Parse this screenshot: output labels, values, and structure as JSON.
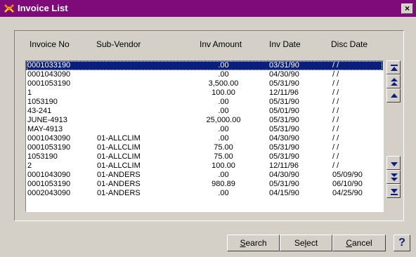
{
  "window": {
    "title": "Invoice List"
  },
  "columns": {
    "invoice_no": "Invoice No",
    "sub_vendor": "Sub-Vendor",
    "inv_amount": "Inv Amount",
    "inv_date": "Inv Date",
    "disc_date": "Disc Date"
  },
  "rows": [
    {
      "invoice_no": "0001033190",
      "sub_vendor": "",
      "inv_amount": ".00",
      "inv_date": "03/31/90",
      "disc_date": "/ /",
      "selected": true
    },
    {
      "invoice_no": "0001043090",
      "sub_vendor": "",
      "inv_amount": ".00",
      "inv_date": "04/30/90",
      "disc_date": "/ /"
    },
    {
      "invoice_no": "0001053190",
      "sub_vendor": "",
      "inv_amount": "3,500.00",
      "inv_date": "05/31/90",
      "disc_date": "/ /"
    },
    {
      "invoice_no": "1",
      "sub_vendor": "",
      "inv_amount": "100.00",
      "inv_date": "12/11/96",
      "disc_date": "/ /"
    },
    {
      "invoice_no": "1053190",
      "sub_vendor": "",
      "inv_amount": ".00",
      "inv_date": "05/31/90",
      "disc_date": "/ /"
    },
    {
      "invoice_no": "43-241",
      "sub_vendor": "",
      "inv_amount": ".00",
      "inv_date": "05/01/90",
      "disc_date": "/ /"
    },
    {
      "invoice_no": "JUNE-4913",
      "sub_vendor": "",
      "inv_amount": "25,000.00",
      "inv_date": "05/31/90",
      "disc_date": "/ /"
    },
    {
      "invoice_no": "MAY-4913",
      "sub_vendor": "",
      "inv_amount": ".00",
      "inv_date": "05/31/90",
      "disc_date": "/ /"
    },
    {
      "invoice_no": "0001043090",
      "sub_vendor": "01-ALLCLIM",
      "inv_amount": ".00",
      "inv_date": "04/30/90",
      "disc_date": "/ /"
    },
    {
      "invoice_no": "0001053190",
      "sub_vendor": "01-ALLCLIM",
      "inv_amount": "75.00",
      "inv_date": "05/31/90",
      "disc_date": "/ /"
    },
    {
      "invoice_no": "1053190",
      "sub_vendor": "01-ALLCLIM",
      "inv_amount": "75.00",
      "inv_date": "05/31/90",
      "disc_date": "/ /"
    },
    {
      "invoice_no": "2",
      "sub_vendor": "01-ALLCLIM",
      "inv_amount": "100.00",
      "inv_date": "12/11/96",
      "disc_date": "/ /"
    },
    {
      "invoice_no": "0001043090",
      "sub_vendor": "01-ANDERS",
      "inv_amount": ".00",
      "inv_date": "04/30/90",
      "disc_date": "05/09/90"
    },
    {
      "invoice_no": "0001053190",
      "sub_vendor": "01-ANDERS",
      "inv_amount": "980.89",
      "inv_date": "05/31/90",
      "disc_date": "06/10/90"
    },
    {
      "invoice_no": "0002043090",
      "sub_vendor": "01-ANDERS",
      "inv_amount": ".00",
      "inv_date": "04/15/90",
      "disc_date": "04/25/90"
    }
  ],
  "buttons": {
    "search": {
      "pre": "",
      "key": "S",
      "post": "earch"
    },
    "select": {
      "pre": "Se",
      "key": "l",
      "post": "ect"
    },
    "cancel": {
      "pre": "",
      "key": "C",
      "post": "ancel"
    },
    "help": "?"
  },
  "colors": {
    "titlebar": "#7f0a7a",
    "selection": "#0a1f7d"
  },
  "icons": {
    "window": "app-logo-icon",
    "close": "close-icon",
    "scroll": [
      "scroll-top-icon",
      "page-up-icon",
      "line-up-icon",
      "line-down-icon",
      "page-down-icon",
      "scroll-bottom-icon"
    ]
  }
}
